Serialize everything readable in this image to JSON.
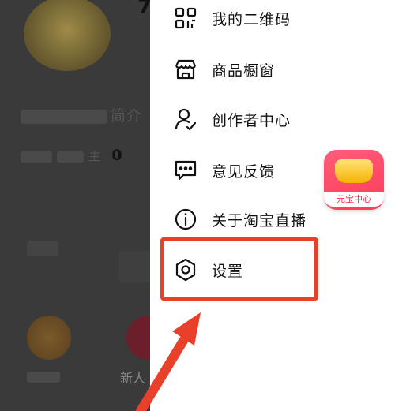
{
  "background": {
    "title_fragment": "7",
    "intro_suffix": "简介",
    "stat_value": "0",
    "stat_label_fragment": "主",
    "shortcut_label": "新人"
  },
  "menu": {
    "items": [
      {
        "label": "我的二维码",
        "icon": "qr-code-icon"
      },
      {
        "label": "商品橱窗",
        "icon": "storefront-icon"
      },
      {
        "label": "创作者中心",
        "icon": "creator-user-check-icon"
      },
      {
        "label": "意见反馈",
        "icon": "feedback-chat-icon"
      },
      {
        "label": "关于淘宝直播",
        "icon": "info-circle-icon"
      },
      {
        "label": "设置",
        "icon": "settings-gear-icon"
      }
    ]
  },
  "badge": {
    "label": "元宝中心",
    "icon": "gold-ingot-icon"
  },
  "colors": {
    "accent": "#e8402a",
    "badge": "#ff3a5a"
  }
}
